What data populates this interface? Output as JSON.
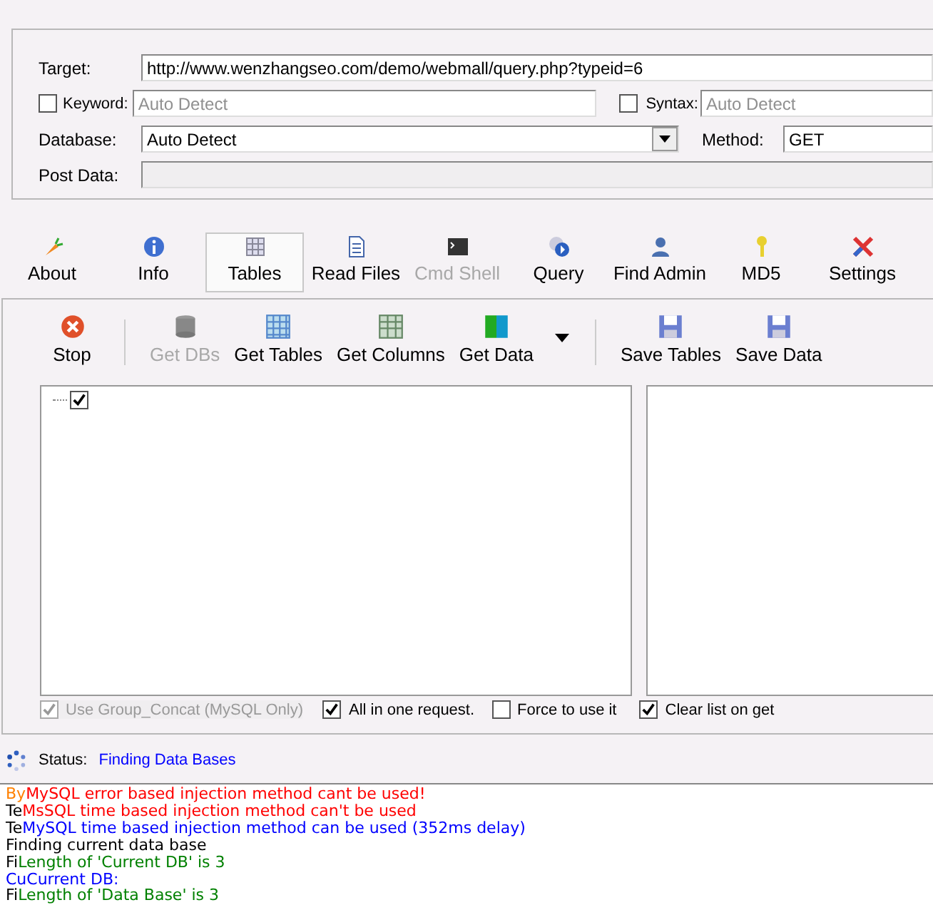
{
  "form": {
    "target": {
      "label": "Target:",
      "value": "http://www.wenzhangseo.com/demo/webmall/query.php?typeid=6"
    },
    "keyword": {
      "label": "Keyword:",
      "checked": false,
      "placeholder": "Auto Detect"
    },
    "syntax": {
      "label": "Syntax:",
      "checked": false,
      "placeholder": "Auto Detect"
    },
    "database": {
      "label": "Database:",
      "value": "Auto Detect"
    },
    "method": {
      "label": "Method:",
      "value": "GET"
    },
    "post_data": {
      "label": "Post Data:"
    }
  },
  "tabs": [
    {
      "label": "About",
      "selected": false,
      "disabled": false
    },
    {
      "label": "Info",
      "selected": false,
      "disabled": false
    },
    {
      "label": "Tables",
      "selected": true,
      "disabled": false
    },
    {
      "label": "Read Files",
      "selected": false,
      "disabled": false
    },
    {
      "label": "Cmd Shell",
      "selected": false,
      "disabled": true
    },
    {
      "label": "Query",
      "selected": false,
      "disabled": false
    },
    {
      "label": "Find Admin",
      "selected": false,
      "disabled": false
    },
    {
      "label": "MD5",
      "selected": false,
      "disabled": false
    },
    {
      "label": "Settings",
      "selected": false,
      "disabled": false
    }
  ],
  "actions": [
    {
      "label": "Stop",
      "disabled": false
    },
    {
      "label": "Get DBs",
      "disabled": true
    },
    {
      "label": "Get Tables",
      "disabled": false
    },
    {
      "label": "Get Columns",
      "disabled": false
    },
    {
      "label": "Get Data",
      "disabled": false
    },
    {
      "label": "Save Tables",
      "disabled": false
    },
    {
      "label": "Save Data",
      "disabled": false
    }
  ],
  "tree": [
    {
      "checked": true
    }
  ],
  "options": [
    {
      "label": "Use Group_Concat (MySQL Only)",
      "checked": true,
      "disabled": true
    },
    {
      "label": "All in one request.",
      "checked": true,
      "disabled": false
    },
    {
      "label": "Force to use it",
      "checked": false,
      "disabled": false
    },
    {
      "label": "Clear list on get",
      "checked": true,
      "disabled": false
    }
  ],
  "status": {
    "label": "Status:",
    "value": "Finding Data Bases"
  },
  "log": [
    {
      "segments": [
        {
          "text": "By",
          "color": "#ff8000"
        },
        {
          "text": "MySQL error based injection method cant be used!",
          "color": "#ff0000"
        }
      ]
    },
    {
      "segments": [
        {
          "text": "Te",
          "color": "#000000"
        },
        {
          "text": "MsSQL time based injection method can't be used",
          "color": "#ff0000"
        }
      ]
    },
    {
      "segments": [
        {
          "text": "Te",
          "color": "#000000"
        },
        {
          "text": "MySQL time based injection method can be used (352ms delay)",
          "color": "#0000ff"
        }
      ]
    },
    {
      "segments": [
        {
          "text": "Finding current data base",
          "color": "#000000"
        }
      ]
    },
    {
      "segments": [
        {
          "text": "Fi",
          "color": "#000000"
        },
        {
          "text": "Length of 'Current DB' is 3",
          "color": "#008000"
        }
      ]
    },
    {
      "segments": [
        {
          "text": "Cu",
          "color": "#0000ff"
        },
        {
          "text": "Current DB:",
          "color": "#0000ff"
        }
      ]
    },
    {
      "segments": [
        {
          "text": "Fi",
          "color": "#000000"
        },
        {
          "text": "Length of 'Data Base' is 3",
          "color": "#008000"
        }
      ]
    }
  ]
}
